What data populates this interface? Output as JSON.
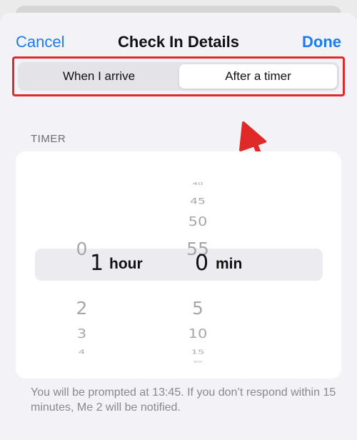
{
  "nav": {
    "cancel_label": "Cancel",
    "title": "Check In Details",
    "done_label": "Done"
  },
  "segmented": {
    "options": [
      "When I arrive",
      "After a timer"
    ],
    "selected": "After a timer"
  },
  "section": {
    "header": "TIMER"
  },
  "picker": {
    "hours_above": [
      "0"
    ],
    "hours_selected": "1",
    "hours_below": [
      "2",
      "3",
      "4"
    ],
    "hours_unit": "hour",
    "minutes_above": [
      "45",
      "50",
      "55"
    ],
    "minutes_selected": "0",
    "minutes_below": [
      "5",
      "10",
      "15"
    ],
    "minutes_unit": "min"
  },
  "footer": {
    "text": "You will be prompted at 13:45. If you don’t respond within 15 minutes, Me 2 will be notified."
  },
  "colors": {
    "accent": "#1a7cf2",
    "annotation": "#e02a2a"
  }
}
